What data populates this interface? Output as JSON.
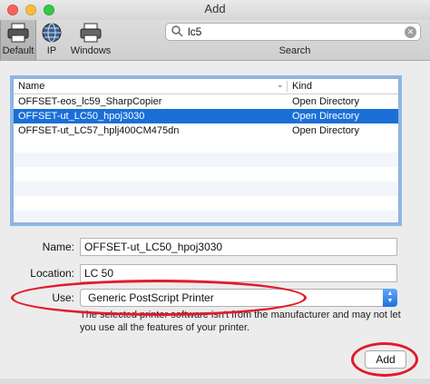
{
  "window": {
    "title": "Add"
  },
  "toolbar": {
    "items": [
      {
        "label": "Default",
        "icon": "printer-default-icon"
      },
      {
        "label": "IP",
        "icon": "globe-icon"
      },
      {
        "label": "Windows",
        "icon": "printer-icon"
      }
    ],
    "search": {
      "value": "lc5",
      "label": "Search"
    }
  },
  "list": {
    "columns": {
      "name": "Name",
      "kind": "Kind"
    },
    "rows": [
      {
        "name": "OFFSET-eos_lc59_SharpCopier",
        "kind": "Open Directory"
      },
      {
        "name": "OFFSET-ut_LC50_hpoj3030",
        "kind": "Open Directory",
        "selected": true
      },
      {
        "name": "OFFSET-ut_LC57_hplj400CM475dn",
        "kind": "Open Directory"
      }
    ]
  },
  "form": {
    "name_label": "Name:",
    "name_value": "OFFSET-ut_LC50_hpoj3030",
    "location_label": "Location:",
    "location_value": "LC 50",
    "use_label": "Use:",
    "use_value": "Generic PostScript Printer",
    "warning": "The selected printer software isn't from the manufacturer and may not let you use all the features of your printer."
  },
  "buttons": {
    "add": "Add"
  },
  "colors": {
    "selection": "#1a6fd7",
    "annotation": "#e21a2a",
    "popup_accent": "#1f6fe0"
  }
}
